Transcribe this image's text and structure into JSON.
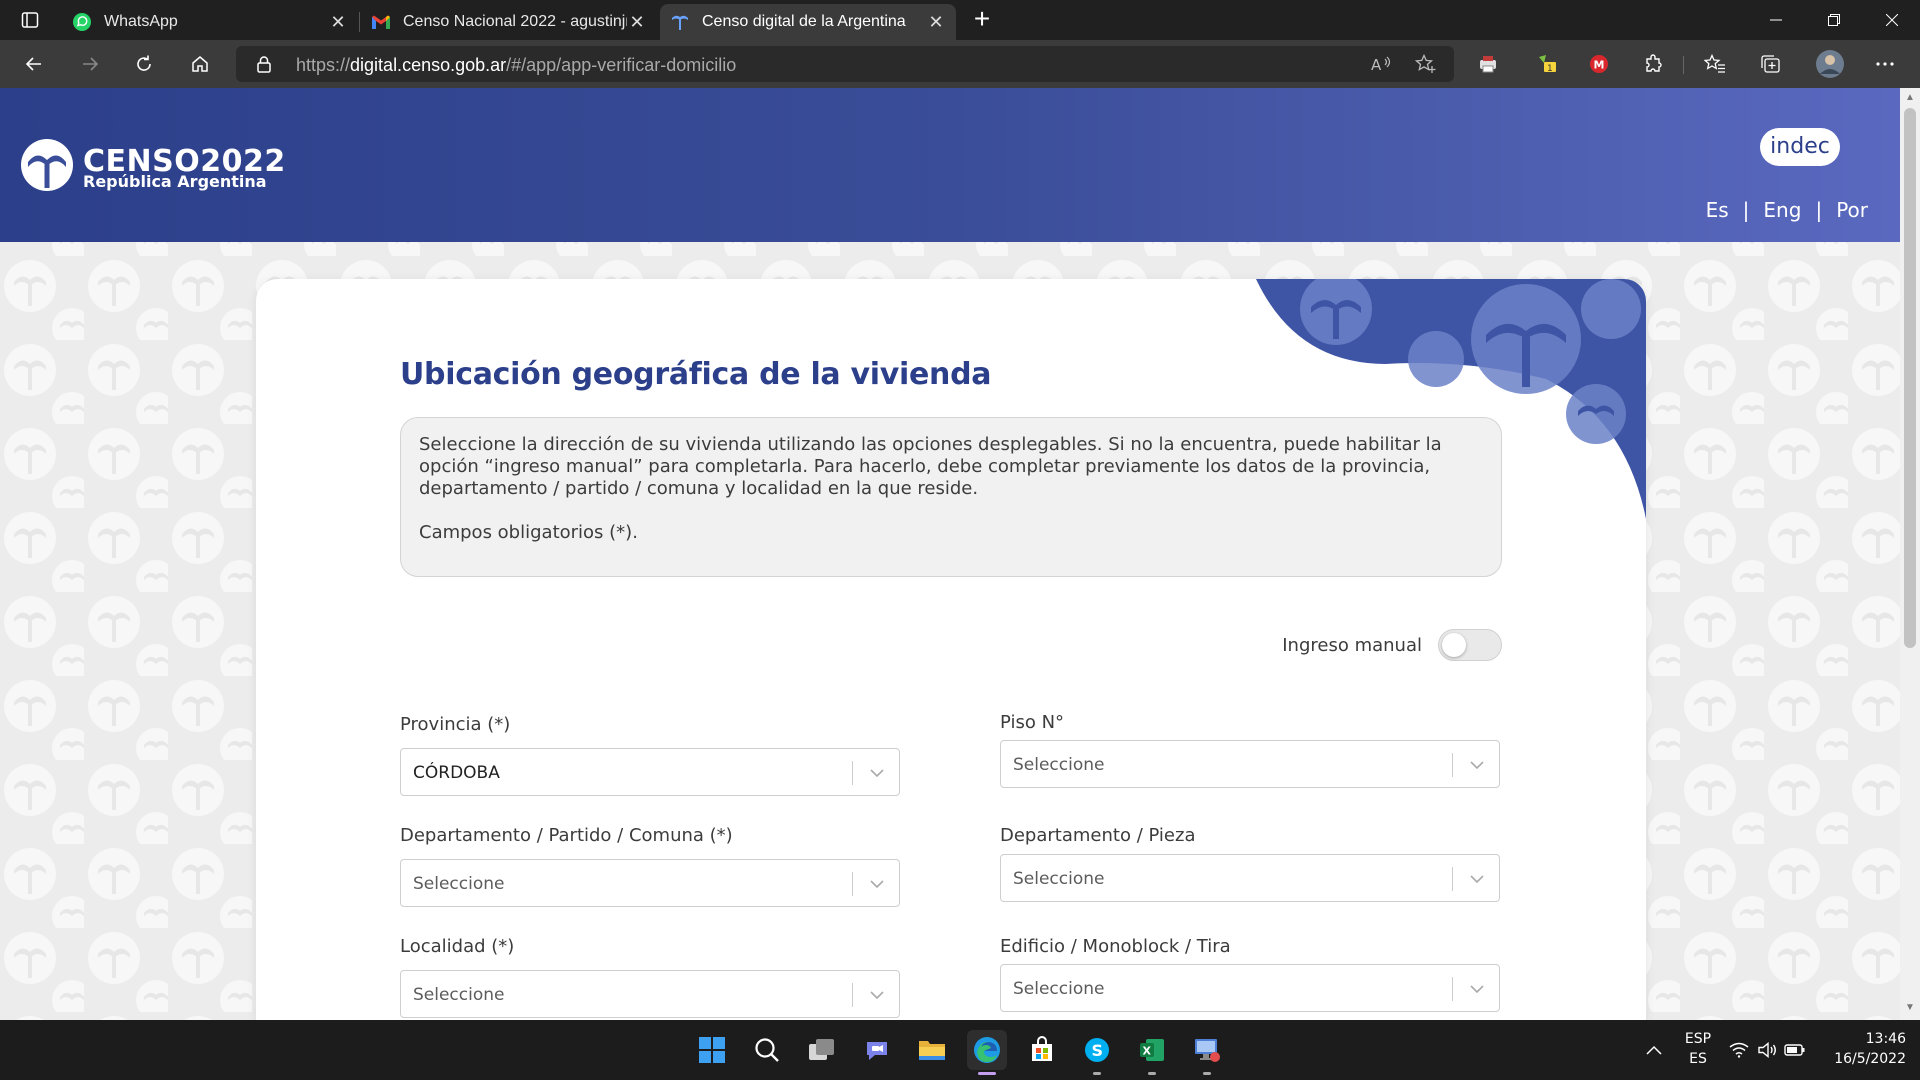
{
  "browser": {
    "tabs": [
      {
        "title": "WhatsApp",
        "icon": "whatsapp-icon",
        "active": false
      },
      {
        "title": "Censo Nacional 2022 - agustinjr",
        "icon": "gmail-icon",
        "active": false
      },
      {
        "title": "Censo digital de la Argentina",
        "icon": "censo-favicon",
        "active": true
      }
    ],
    "url_prefix": "https://",
    "url_host": "digital.censo.gob.ar",
    "url_path": "/#/app/app-verificar-domicilio"
  },
  "site": {
    "logo_title": "CENSO2022",
    "logo_subtitle": "República Argentina",
    "badge": "indec",
    "languages": [
      "Es",
      "Eng",
      "Por"
    ],
    "language_separator": "|"
  },
  "form": {
    "heading": "Ubicación geográfica de la vivienda",
    "info_text": "Seleccione la dirección de su vivienda utilizando las opciones desplegables. Si no la encuentra, puede habilitar la opción “ingreso manual” para completarla. Para hacerlo, debe completar previamente los datos de la provincia, departamento / partido / comuna y localidad en la que reside.",
    "required_note": "Campos obligatorios (*).",
    "manual_toggle_label": "Ingreso manual",
    "manual_toggle_on": false,
    "fields": {
      "provincia": {
        "label": "Provincia (*)",
        "value": "CÓRDOBA"
      },
      "departamento": {
        "label": "Departamento / Partido / Comuna (*)",
        "value": "Seleccione"
      },
      "localidad": {
        "label": "Localidad (*)",
        "value": "Seleccione"
      },
      "piso": {
        "label": "Piso N°",
        "value": "Seleccione"
      },
      "depto_pieza": {
        "label": "Departamento / Pieza",
        "value": "Seleccione"
      },
      "edificio": {
        "label": "Edificio / Monoblock / Tira",
        "value": "Seleccione"
      }
    }
  },
  "taskbar": {
    "apps": [
      "windows-start-icon",
      "search-icon",
      "task-view-icon",
      "teams-chat-icon",
      "file-explorer-icon",
      "edge-icon",
      "store-icon",
      "skype-icon",
      "excel-icon",
      "remote-desktop-icon"
    ],
    "lang_top": "ESP",
    "lang_bottom": "ES",
    "time": "13:46",
    "date": "16/5/2022"
  },
  "colors": {
    "brand_blue": "#2c3f8a",
    "header_gradient_end": "#5a69bf"
  }
}
